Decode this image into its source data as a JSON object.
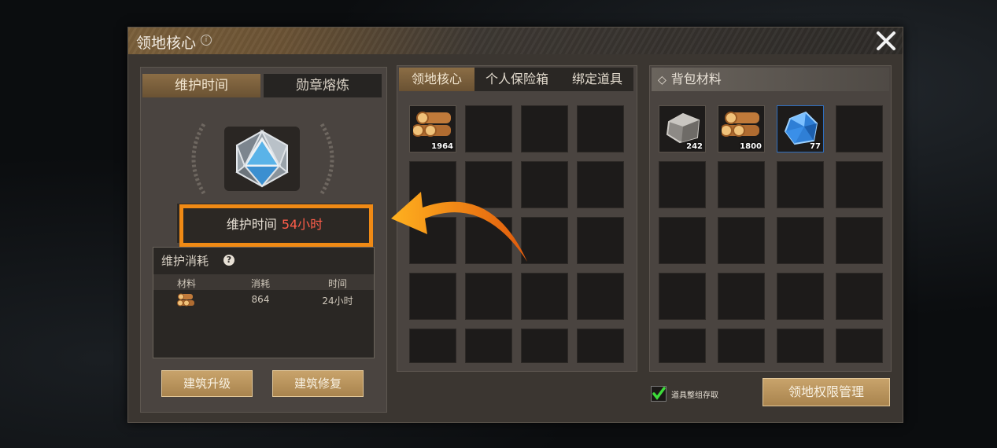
{
  "window": {
    "title": "领地核心",
    "info_glyph": "i"
  },
  "left": {
    "tabs": [
      {
        "label": "维护时间"
      },
      {
        "label": "勋章熔炼"
      }
    ],
    "status": {
      "label": "维护时间",
      "value": "54小时"
    },
    "upkeep": {
      "title": "维护消耗",
      "help_glyph": "?",
      "columns": [
        "材料",
        "消耗",
        "时间"
      ],
      "row": {
        "material_icon": "wood-logs-icon",
        "consume": "864",
        "time": "24小时"
      }
    },
    "buttons": {
      "upgrade": "建筑升级",
      "repair": "建筑修复"
    }
  },
  "middle": {
    "tabs": [
      {
        "label": "领地核心"
      },
      {
        "label": "个人保险箱"
      },
      {
        "label": "绑定道具"
      }
    ],
    "items": [
      {
        "icon": "wood-logs-icon",
        "qty": "1964"
      }
    ]
  },
  "right": {
    "title": "背包材料",
    "items": [
      {
        "icon": "stone-icon",
        "qty": "242"
      },
      {
        "icon": "wood-logs-icon",
        "qty": "1800"
      },
      {
        "icon": "crystal-ore-icon",
        "qty": "77"
      }
    ]
  },
  "footer": {
    "checkbox_label": "道具整组存取",
    "checked": true,
    "permission_button": "领地权限管理"
  },
  "colors": {
    "accent_orange": "#f08a15",
    "time_red": "#ff5d4a",
    "button_gold": "#c8a36b"
  }
}
